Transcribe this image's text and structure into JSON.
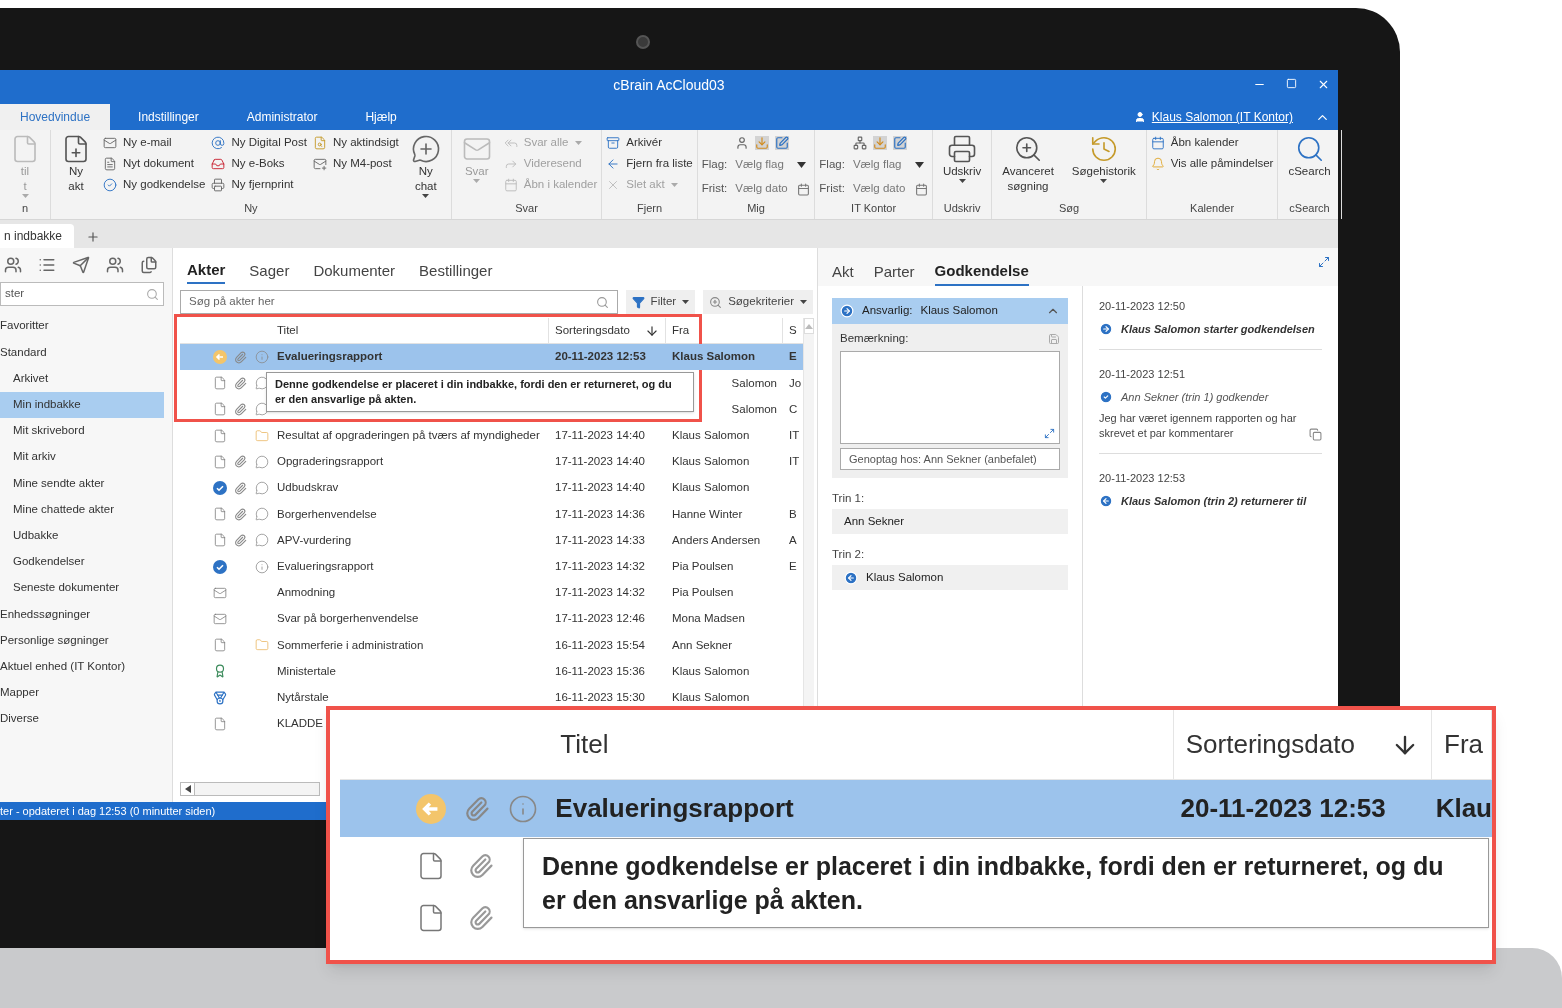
{
  "window": {
    "title": "cBrain AcCloud03"
  },
  "menu_tabs": [
    {
      "label": "Hovedvindue",
      "selected": true
    },
    {
      "label": "Indstillinger",
      "selected": false
    },
    {
      "label": "Administrator",
      "selected": false
    },
    {
      "label": "Hjælp",
      "selected": false
    }
  ],
  "user_link": "Klaus Salomon (IT Kontor)",
  "ribbon": {
    "groups": [
      {
        "label": "n",
        "columns": [
          {
            "kind": "large",
            "lines": [
              "til",
              "t"
            ],
            "dropdown": true,
            "disabled": true
          }
        ]
      },
      {
        "label": "Ny",
        "columns": [
          {
            "kind": "large",
            "lines": [
              "Ny",
              "akt"
            ],
            "dropdown": false,
            "disabled": false
          },
          {
            "kind": "stack",
            "items": [
              {
                "label": "Ny e-mail",
                "disabled": false,
                "dropdown": false
              },
              {
                "label": "Nyt dokument",
                "disabled": false,
                "dropdown": false
              },
              {
                "label": "Ny godkendelse",
                "disabled": false,
                "dropdown": false
              }
            ]
          },
          {
            "kind": "stack",
            "items": [
              {
                "label": "Ny Digital Post",
                "disabled": false,
                "dropdown": false
              },
              {
                "label": "Ny e-Boks",
                "disabled": false,
                "dropdown": false
              },
              {
                "label": "Ny fjernprint",
                "disabled": false,
                "dropdown": false
              }
            ]
          },
          {
            "kind": "stack",
            "items": [
              {
                "label": "Ny aktindsigt",
                "disabled": false,
                "dropdown": false
              },
              {
                "label": "Ny M4-post",
                "disabled": false,
                "dropdown": false
              }
            ]
          },
          {
            "kind": "large",
            "lines": [
              "Ny",
              "chat"
            ],
            "dropdown": true,
            "disabled": false
          }
        ]
      },
      {
        "label": "Svar",
        "columns": [
          {
            "kind": "large",
            "lines": [
              "Svar"
            ],
            "dropdown": true,
            "disabled": true
          },
          {
            "kind": "stack",
            "items": [
              {
                "label": "Svar alle",
                "disabled": true,
                "dropdown": true
              },
              {
                "label": "Videresend",
                "disabled": true,
                "dropdown": false
              },
              {
                "label": "Åbn i kalender",
                "disabled": true,
                "dropdown": false
              }
            ]
          }
        ]
      },
      {
        "label": "Fjern",
        "columns": [
          {
            "kind": "stack",
            "items": [
              {
                "label": "Arkivér",
                "disabled": false,
                "dropdown": false
              },
              {
                "label": "Fjern fra liste",
                "disabled": false,
                "dropdown": false
              },
              {
                "label": "Slet akt",
                "disabled": true,
                "dropdown": true
              }
            ]
          }
        ]
      },
      {
        "label": "Mig",
        "columns": [
          {
            "kind": "flag",
            "flag_label": "Flag:",
            "flag_value": "Vælg flag",
            "date_label": "Frist:",
            "date_value": "Vælg dato"
          }
        ]
      },
      {
        "label": "IT Kontor",
        "columns": [
          {
            "kind": "flag",
            "flag_label": "Flag:",
            "flag_value": "Vælg flag",
            "date_label": "Frist:",
            "date_value": "Vælg dato"
          }
        ]
      },
      {
        "label": "Udskriv",
        "columns": [
          {
            "kind": "large",
            "lines": [
              "Udskriv"
            ],
            "dropdown": true,
            "disabled": false
          }
        ]
      },
      {
        "label": "Søg",
        "columns": [
          {
            "kind": "large",
            "lines": [
              "Avanceret",
              "søgning"
            ],
            "dropdown": false,
            "disabled": false
          },
          {
            "kind": "large",
            "lines": [
              "Søgehistorik"
            ],
            "dropdown": true,
            "disabled": false
          }
        ]
      },
      {
        "label": "Kalender",
        "columns": [
          {
            "kind": "stack",
            "items": [
              {
                "label": "Åbn kalender",
                "disabled": false,
                "dropdown": false
              },
              {
                "label": "Vis alle påmindelser",
                "disabled": false,
                "dropdown": false
              }
            ]
          }
        ]
      },
      {
        "label": "cSearch",
        "columns": [
          {
            "kind": "large",
            "lines": [
              "cSearch"
            ],
            "dropdown": false,
            "disabled": false
          }
        ]
      }
    ]
  },
  "doc_tabs": [
    {
      "label": "n indbakke",
      "selected": true
    }
  ],
  "sidebar": {
    "search_value": "ster",
    "items": [
      {
        "kind": "header",
        "label": "Favoritter",
        "selected": false
      },
      {
        "kind": "header",
        "label": "Standard",
        "selected": false
      },
      {
        "kind": "item",
        "label": "Arkivet",
        "selected": false
      },
      {
        "kind": "item",
        "label": "Min indbakke",
        "selected": true
      },
      {
        "kind": "item",
        "label": "Mit skrivebord",
        "selected": false
      },
      {
        "kind": "item",
        "label": "Mit arkiv",
        "selected": false
      },
      {
        "kind": "item",
        "label": "Mine sendte akter",
        "selected": false
      },
      {
        "kind": "item",
        "label": "Mine chattede akter",
        "selected": false
      },
      {
        "kind": "item",
        "label": "Udbakke",
        "selected": false
      },
      {
        "kind": "item",
        "label": "Godkendelser",
        "selected": false
      },
      {
        "kind": "item",
        "label": "Seneste dokumenter",
        "selected": false
      },
      {
        "kind": "header",
        "label": "Enhedssøgninger",
        "selected": false
      },
      {
        "kind": "header",
        "label": "Personlige søgninger",
        "selected": false
      },
      {
        "kind": "header",
        "label": "Aktuel enhed (IT Kontor)",
        "selected": false
      },
      {
        "kind": "header",
        "label": "Mapper",
        "selected": false
      },
      {
        "kind": "header",
        "label": "Diverse",
        "selected": false
      }
    ]
  },
  "list": {
    "tabs": [
      {
        "label": "Akter",
        "selected": true
      },
      {
        "label": "Sager",
        "selected": false
      },
      {
        "label": "Dokumenter",
        "selected": false
      },
      {
        "label": "Bestillinger",
        "selected": false
      }
    ],
    "search_placeholder": "Søg på akter her",
    "filter_button": "Filter",
    "criteria_button": "Søgekriterier",
    "columns": [
      {
        "label": "Titel",
        "sorted": false
      },
      {
        "label": "Sorteringsdato",
        "sorted": true
      },
      {
        "label": "Fra",
        "sorted": false
      },
      {
        "label": "S",
        "sorted": false
      }
    ],
    "rows": [
      {
        "kind": "returned",
        "attachment": true,
        "info": true,
        "chat": false,
        "folder": false,
        "title": "Evalueringsrapport",
        "date": "20-11-2023 12:53",
        "from": "Klaus Salomon",
        "column_4": "E",
        "selected": true
      },
      {
        "kind": "document",
        "attachment": true,
        "info": false,
        "chat": true,
        "folder": false,
        "from": "Salomon",
        "column_4": "Jo",
        "selected": false
      },
      {
        "kind": "document",
        "attachment": true,
        "info": false,
        "chat": true,
        "folder": false,
        "from": "Salomon",
        "column_4": "C",
        "selected": false
      },
      {
        "kind": "document",
        "attachment": false,
        "info": false,
        "chat": false,
        "folder": true,
        "title": "Resultat af opgraderingen på tværs af myndigheder",
        "date": "17-11-2023 14:40",
        "from": "Klaus Salomon",
        "column_4": "IT",
        "selected": false
      },
      {
        "kind": "document",
        "attachment": true,
        "info": false,
        "chat": true,
        "folder": false,
        "title": "Opgraderingsrapport",
        "date": "17-11-2023 14:40",
        "from": "Klaus Salomon",
        "column_4": "IT",
        "selected": false
      },
      {
        "kind": "approved",
        "attachment": true,
        "info": false,
        "chat": true,
        "folder": false,
        "title": "Udbudskrav",
        "date": "17-11-2023 14:40",
        "from": "Klaus Salomon",
        "selected": false
      },
      {
        "kind": "document",
        "attachment": true,
        "info": false,
        "chat": true,
        "folder": false,
        "title": "Borgerhenvendelse",
        "date": "17-11-2023 14:36",
        "from": "Hanne Winter",
        "column_4": "B",
        "selected": false
      },
      {
        "kind": "document",
        "attachment": true,
        "info": false,
        "chat": true,
        "folder": false,
        "title": "APV-vurdering",
        "date": "17-11-2023 14:33",
        "from": "Anders Andersen",
        "column_4": "A",
        "selected": false
      },
      {
        "kind": "approved",
        "attachment": false,
        "info": true,
        "chat": false,
        "folder": false,
        "title": "Evalueringsrapport",
        "date": "17-11-2023 14:32",
        "from": "Pia Poulsen",
        "column_4": "E",
        "selected": false
      },
      {
        "kind": "mail",
        "attachment": false,
        "info": false,
        "chat": false,
        "folder": false,
        "title": "Anmodning",
        "date": "17-11-2023 14:32",
        "from": "Pia Poulsen",
        "selected": false
      },
      {
        "kind": "mail",
        "attachment": false,
        "info": false,
        "chat": false,
        "folder": false,
        "title": "Svar på borgerhenvendelse",
        "date": "17-11-2023 12:46",
        "from": "Mona Madsen",
        "selected": false
      },
      {
        "kind": "document",
        "attachment": false,
        "info": false,
        "chat": false,
        "folder": true,
        "title": "Sommerferie i administration",
        "date": "16-11-2023 15:54",
        "from": "Ann Sekner",
        "selected": false
      },
      {
        "kind": "award",
        "attachment": false,
        "info": false,
        "chat": false,
        "folder": false,
        "title": "Ministertale",
        "date": "16-11-2023 15:36",
        "from": "Klaus Salomon",
        "selected": false
      },
      {
        "kind": "medal",
        "attachment": false,
        "info": false,
        "chat": false,
        "folder": false,
        "title": "Nytårstale",
        "date": "16-11-2023 15:30",
        "from": "Klaus Salomon",
        "selected": false
      },
      {
        "kind": "document",
        "attachment": false,
        "info": false,
        "chat": false,
        "folder": false,
        "title": "KLADDE",
        "selected": false
      }
    ],
    "tooltip": "Denne godkendelse er placeret i din indbakke, fordi den er returneret, og du er den ansvarlige på akten."
  },
  "detail": {
    "tabs": [
      {
        "label": "Akt",
        "selected": false
      },
      {
        "label": "Parter",
        "selected": false
      },
      {
        "label": "Godkendelse",
        "selected": true
      }
    ],
    "responsible_label": "Ansvarlig:",
    "responsible_name": "Klaus Salomon",
    "remark_label": "Bemærkning:",
    "resume_field": "Genoptag hos: Ann Sekner (anbefalet)",
    "steps": [
      {
        "label": "Trin 1:",
        "name": "Ann Sekner",
        "kind": "plain"
      },
      {
        "label": "Trin 2:",
        "name": "Klaus Salomon",
        "kind": "returned"
      }
    ],
    "history": [
      {
        "time": "20-11-2023 12:50",
        "kind": "start",
        "text": "Klaus Salomon starter godkendelsen"
      },
      {
        "time": "20-11-2023 12:51",
        "kind": "approve",
        "text": "Ann Sekner (trin 1) godkender",
        "comment": "Jeg har været igennem rapporten og har skrevet et par kommentarer"
      },
      {
        "time": "20-11-2023 12:53",
        "kind": "return",
        "text": "Klaus Salomon (trin 2) returnerer til"
      }
    ]
  },
  "status_bar": "ter - opdateret i dag 12:53 (0 minutter siden)",
  "callout": {
    "columns": [
      "Titel",
      "Sorteringsdato",
      "Fra"
    ],
    "title": "Evalueringsrapport",
    "date": "20-11-2023 12:53",
    "from": "Klau",
    "tooltip": "Denne godkendelse er placeret i din indbakke, fordi den er returneret, og du er den ansvarlige på akten."
  }
}
